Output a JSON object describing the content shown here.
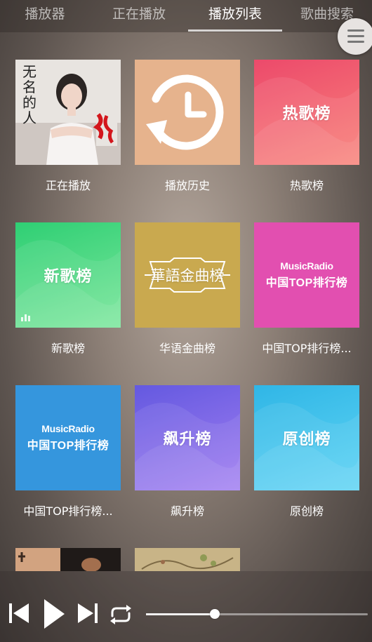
{
  "tabs": [
    {
      "label": "播放器",
      "active": false
    },
    {
      "label": "正在播放",
      "active": false
    },
    {
      "label": "播放列表",
      "active": true
    },
    {
      "label": "歌曲搜索",
      "active": false
    }
  ],
  "grid": {
    "items": [
      {
        "caption": "正在播放",
        "cover_text": "",
        "cover_type": "album-photo"
      },
      {
        "caption": "播放历史",
        "cover_text": "",
        "cover_type": "history-icon"
      },
      {
        "caption": "热歌榜",
        "cover_text": "热歌榜",
        "cover_type": "gradient"
      },
      {
        "caption": "新歌榜",
        "cover_text": "新歌榜",
        "cover_type": "gradient"
      },
      {
        "caption": "华语金曲榜",
        "cover_text": "華語金曲榜",
        "cover_type": "banner"
      },
      {
        "caption": "中国TOP排行榜...",
        "cover_text": "中国TOP排行榜",
        "cover_subtext": "MusicRadio",
        "cover_type": "musicradio"
      },
      {
        "caption": "中国TOP排行榜...",
        "cover_text": "中国TOP排行榜",
        "cover_subtext": "MusicRadio",
        "cover_type": "musicradio"
      },
      {
        "caption": "飙升榜",
        "cover_text": "飙升榜",
        "cover_type": "gradient"
      },
      {
        "caption": "原创榜",
        "cover_text": "原创榜",
        "cover_type": "gradient"
      },
      {
        "caption": "",
        "cover_text": "",
        "cover_type": "photo"
      },
      {
        "caption": "",
        "cover_text": "",
        "cover_type": "painting"
      }
    ],
    "album_art_text": "无名的人"
  },
  "player": {
    "progress": 0.31
  },
  "colors": {
    "history": "#e6b38d",
    "hot": [
      "#ec4a6b",
      "#f9827a"
    ],
    "new": [
      "#2fcf74",
      "#7ae69b"
    ],
    "chinese_gold": "#c9a94f",
    "musicradio_pink": "#e24fb0",
    "musicradio_blue": "#3596dd",
    "soaring": [
      "#6459e0",
      "#a27ff1"
    ],
    "original": [
      "#30b6e6",
      "#5fd4f4"
    ]
  }
}
